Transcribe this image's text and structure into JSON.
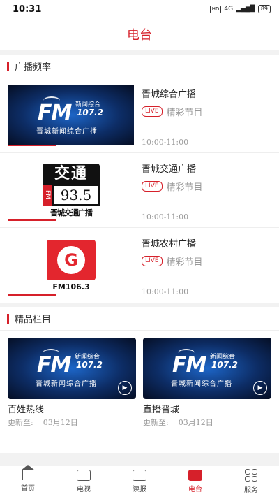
{
  "status_bar": {
    "time": "10:31",
    "hd": "HD",
    "network": "4G",
    "battery": "89"
  },
  "header": {
    "title": "电台"
  },
  "broadcast": {
    "section_title": "广播频率",
    "live_label": "LIVE",
    "items": [
      {
        "name": "晋城综合广播",
        "program": "精彩节目",
        "time": "10:00-11:00",
        "logo": "fm-107-2-logo",
        "logo_text": {
          "fm": "FM",
          "top": "新闻综合",
          "num": "107.2",
          "sub": "晋城新闻综合广播"
        }
      },
      {
        "name": "晋城交通广播",
        "program": "精彩节目",
        "time": "10:00-11:00",
        "logo": "traffic-93-5-logo",
        "logo_text": {
          "top": "交通",
          "fm": "FM",
          "num": "93.5",
          "bottom": "晋城交通广播"
        }
      },
      {
        "name": "晋城农村广播",
        "program": "精彩节目",
        "time": "10:00-11:00",
        "logo": "fm-106-3-logo",
        "logo_text": {
          "letter": "G",
          "freq": "FM106.3"
        }
      }
    ]
  },
  "featured": {
    "section_title": "精品栏目",
    "items": [
      {
        "name": "百姓热线",
        "update_label": "更新至:",
        "date": "03月12日"
      },
      {
        "name": "直播晋城",
        "update_label": "更新至:",
        "date": "03月12日"
      }
    ],
    "logo_text": {
      "fm": "FM",
      "top": "新闻综合",
      "num": "107.2",
      "sub": "晋城新闻综合广播"
    }
  },
  "bottom_nav": {
    "items": [
      {
        "label": "首页",
        "icon": "home-icon"
      },
      {
        "label": "电视",
        "icon": "tv-icon"
      },
      {
        "label": "读报",
        "icon": "newspaper-icon"
      },
      {
        "label": "电台",
        "icon": "radio-icon",
        "active": true
      },
      {
        "label": "服务",
        "icon": "grid-icon"
      }
    ]
  },
  "colors": {
    "accent": "#d6202a"
  }
}
